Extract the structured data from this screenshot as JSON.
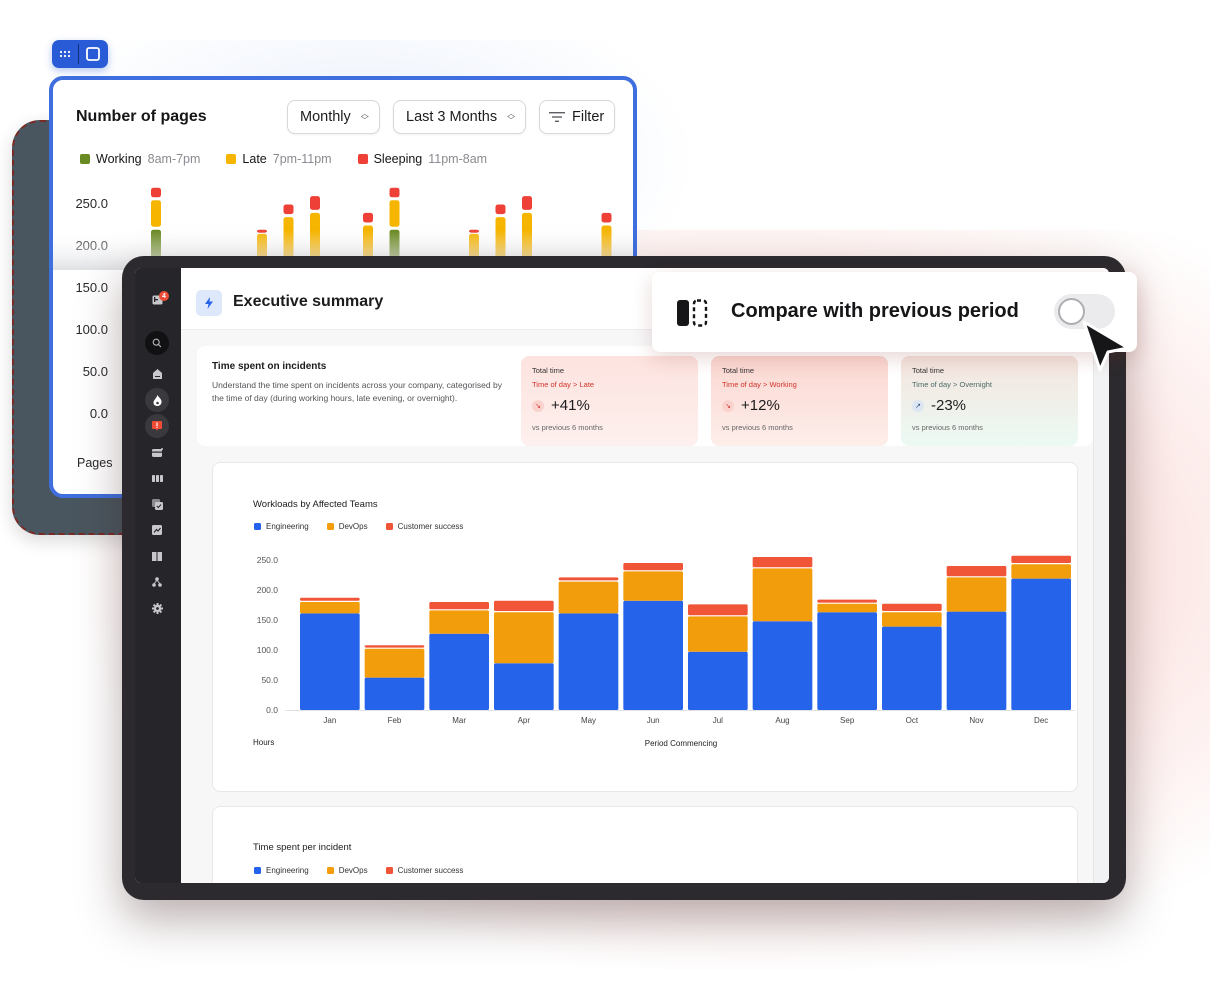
{
  "toolbar_chip": {
    "left_icon": "grid-dots-icon",
    "right_icon": "frame-icon"
  },
  "pages_card": {
    "title": "Number of pages",
    "controls": {
      "period": "Monthly",
      "range": "Last 3 Months",
      "filter": "Filter"
    },
    "legend": [
      {
        "label": "Working",
        "sub": "8am-7pm",
        "color": "#6a8a23"
      },
      {
        "label": "Late",
        "sub": "7pm-11pm",
        "color": "#f6b500"
      },
      {
        "label": "Sleeping",
        "sub": "11pm-8am",
        "color": "#ef4037"
      }
    ],
    "y_ticks": [
      "250.0",
      "200.0",
      "150.0",
      "100.0",
      "50.0",
      "0.0"
    ],
    "y_axis_label": "Pages"
  },
  "sidebar": {
    "badge_count": "4",
    "items": [
      {
        "icon": "inbox-icon"
      },
      {
        "icon": "search-icon"
      },
      {
        "icon": "home-icon"
      },
      {
        "icon": "incident-fire-icon",
        "active": true
      },
      {
        "icon": "alert-icon",
        "active": true
      },
      {
        "icon": "status-page-icon"
      },
      {
        "icon": "columns-icon"
      },
      {
        "icon": "workflows-icon"
      },
      {
        "icon": "insights-icon"
      },
      {
        "icon": "catalog-book-icon"
      },
      {
        "icon": "team-tree-icon"
      },
      {
        "icon": "settings-gear-icon"
      }
    ]
  },
  "header": {
    "title": "Executive summary",
    "icon": "bolt-icon"
  },
  "summary": {
    "title": "Time spent on incidents",
    "description": "Understand the time spent on incidents across your company, categorised by the time of day (during working hours, late evening, or overnight).",
    "stats": [
      {
        "label": "Total time",
        "crumb_a": "Time of day",
        "crumb_b": "Late",
        "value": "+41%",
        "note": "vs previous 6 months",
        "trend": "trend-down-icon"
      },
      {
        "label": "Total time",
        "crumb_a": "Time of day",
        "crumb_b": "Working",
        "value": "+12%",
        "note": "vs previous 6 months",
        "trend": "trend-down-icon"
      },
      {
        "label": "Total time",
        "crumb_a": "Time of day",
        "crumb_b": "Overnight",
        "value": "-23%",
        "note": "vs previous 6 months",
        "trend": "trend-up-icon"
      }
    ],
    "crumb_sep": ">"
  },
  "compare_popup": {
    "label": "Compare with previous period",
    "toggle_on": false
  },
  "second_card": {
    "title": "Time spent per incident",
    "legend": [
      "Engineering",
      "DevOps",
      "Customer success"
    ]
  },
  "colors": {
    "engineering": "#2563eb",
    "devops": "#f29d0c",
    "customer_success": "#f05538"
  },
  "chart_data": [
    {
      "type": "bar",
      "stacked": true,
      "title": "Workloads by Affected Teams",
      "categories": [
        "Jan",
        "Feb",
        "Mar",
        "Apr",
        "May",
        "Jun",
        "Jul",
        "Aug",
        "Sep",
        "Oct",
        "Nov",
        "Dec"
      ],
      "series": [
        {
          "name": "Engineering",
          "values": [
            161,
            54,
            127,
            78,
            161,
            182,
            97,
            148,
            163,
            139,
            164,
            219
          ]
        },
        {
          "name": "DevOps",
          "values": [
            21,
            50,
            41,
            87,
            55,
            51,
            61,
            90,
            16,
            26,
            59,
            26
          ]
        },
        {
          "name": "Customer success",
          "values": [
            7,
            6,
            14,
            19,
            7,
            14,
            20,
            19,
            7,
            14,
            19,
            14
          ]
        }
      ],
      "y_ticks": [
        "250.0",
        "200.0",
        "150.0",
        "100.0",
        "50.0",
        "0.0"
      ],
      "xlabel": "Period Commencing",
      "ylabel": "Hours",
      "ylim": [
        0,
        250
      ],
      "legend": "top-left",
      "grid": false
    },
    {
      "type": "bar",
      "stacked": true,
      "title": "Number of pages",
      "note": "partially occluded; only upper portions visible",
      "series": [
        {
          "name": "Working",
          "values": [
            220,
            0,
            0,
            0,
            0,
            0,
            0,
            0,
            0,
            220,
            0,
            0,
            0,
            0,
            0,
            0,
            0,
            0,
            0,
            220
          ]
        },
        {
          "name": "Late",
          "values": [
            35,
            0,
            0,
            0,
            215,
            235,
            240,
            0,
            225,
            35,
            0,
            0,
            215,
            235,
            240,
            0,
            0,
            225,
            35
          ]
        },
        {
          "name": "Sleeping",
          "values": [
            15,
            5,
            0,
            0,
            5,
            15,
            20,
            5,
            15,
            15,
            5,
            0,
            5,
            15,
            20,
            5,
            0,
            15,
            15
          ]
        }
      ],
      "y_ticks": [
        "250.0",
        "200.0",
        "150.0",
        "100.0",
        "50.0",
        "0.0"
      ],
      "ylabel": "Pages",
      "ylim": [
        0,
        250
      ]
    }
  ]
}
